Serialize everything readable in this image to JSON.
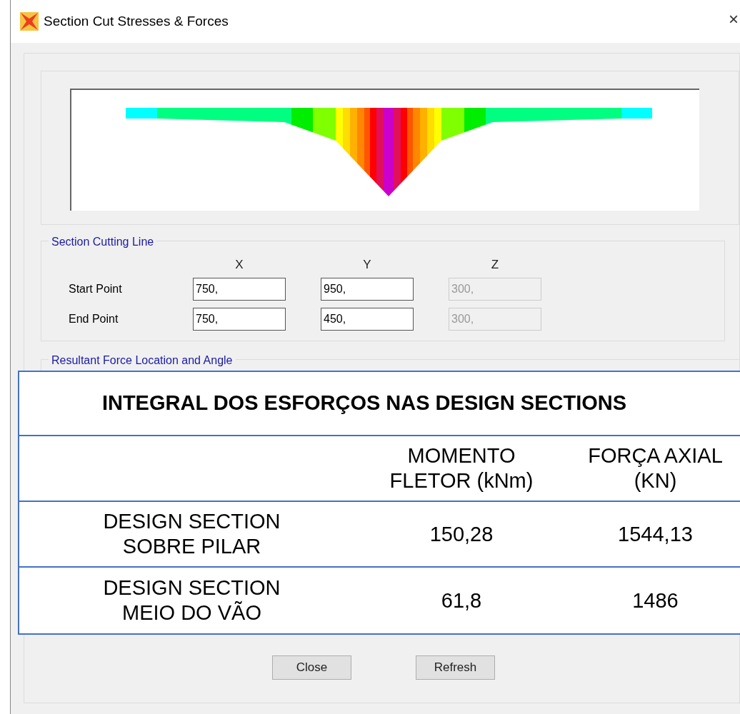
{
  "window": {
    "title": "Section Cut Stresses & Forces",
    "close_glyph": "×"
  },
  "section_cutting_line": {
    "title": "Section Cutting Line",
    "columns": [
      "X",
      "Y",
      "Z"
    ],
    "rows": [
      {
        "label": "Start Point",
        "values": [
          {
            "value": "750,",
            "disabled": false
          },
          {
            "value": "950,",
            "disabled": false
          },
          {
            "value": "300,",
            "disabled": true
          }
        ]
      },
      {
        "label": "End Point",
        "values": [
          {
            "value": "750,",
            "disabled": false
          },
          {
            "value": "450,",
            "disabled": false
          },
          {
            "value": "300,",
            "disabled": true
          }
        ]
      }
    ]
  },
  "resultant_group": {
    "title": "Resultant Force Location and Angle"
  },
  "overlay_table": {
    "title": "INTEGRAL DOS ESFORÇOS NAS DESIGN SECTIONS",
    "columns": [
      "",
      "MOMENTO FLETOR (kNm)",
      "FORÇA AXIAL (KN)"
    ],
    "rows": [
      [
        "DESIGN SECTION SOBRE PILAR",
        "150,28",
        "1544,13"
      ],
      [
        "DESIGN SECTION MEIO DO VÃO",
        "61,8",
        "1486"
      ]
    ]
  },
  "buttons": [
    "Close",
    "Refresh"
  ]
}
